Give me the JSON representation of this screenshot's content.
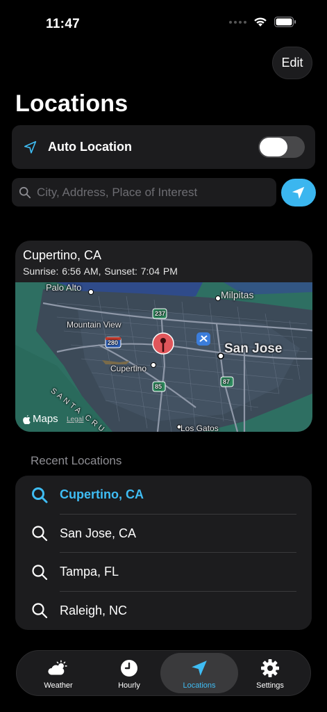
{
  "status": {
    "time": "11:47"
  },
  "header": {
    "edit_label": "Edit",
    "title": "Locations"
  },
  "auto_location": {
    "label": "Auto Location",
    "enabled": false
  },
  "search": {
    "placeholder": "City, Address, Place of Interest",
    "value": ""
  },
  "map_card": {
    "city": "Cupertino, CA",
    "sun_info": "Sunrise:  6:56 AM, Sunset:  7:04 PM",
    "labels": {
      "palo_alto": "Palo Alto",
      "milpitas": "Milpitas",
      "mountain_view": "Mountain View",
      "san_jose": "San Jose",
      "cupertino": "Cupertino",
      "los_gatos": "Los Gatos",
      "santa_cruz": "SANTA CRU",
      "hwy_237": "237",
      "hwy_280": "280",
      "hwy_85": "85",
      "hwy_87": "87"
    },
    "brand": "Maps",
    "legal": "Legal"
  },
  "recent": {
    "title": "Recent Locations",
    "items": [
      {
        "label": "Cupertino, CA",
        "active": true
      },
      {
        "label": "San Jose, CA",
        "active": false
      },
      {
        "label": "Tampa, FL",
        "active": false
      },
      {
        "label": "Raleigh, NC",
        "active": false
      }
    ]
  },
  "tabs": [
    {
      "label": "Weather",
      "icon": "weather-icon"
    },
    {
      "label": "Hourly",
      "icon": "clock-icon"
    },
    {
      "label": "Locations",
      "icon": "location-arrow-icon",
      "active": true
    },
    {
      "label": "Settings",
      "icon": "gear-icon"
    }
  ],
  "colors": {
    "accent": "#3fbdf4",
    "card": "#1c1c1e",
    "background": "#000000"
  }
}
